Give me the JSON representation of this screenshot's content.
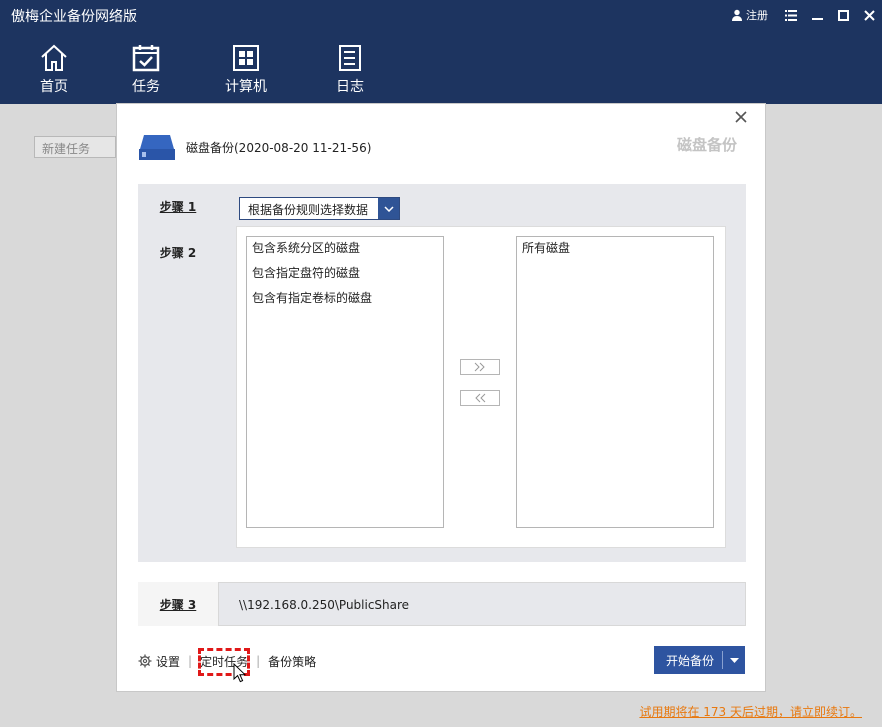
{
  "app": {
    "title": "傲梅企业备份网络版"
  },
  "window": {
    "login_label": "注册"
  },
  "nav": {
    "items": [
      {
        "label": "首页",
        "icon": "home-icon"
      },
      {
        "label": "任务",
        "icon": "task-icon"
      },
      {
        "label": "计算机",
        "icon": "computer-icon"
      },
      {
        "label": "日志",
        "icon": "log-icon"
      }
    ]
  },
  "background": {
    "new_task_label": "新建任务"
  },
  "dialog": {
    "header_text": "磁盘备份(2020-08-20 11-21-56)",
    "ghost_title": "磁盘备份",
    "steps": {
      "step1": "步骤 1",
      "step2": "步骤 2",
      "step3": "步骤 3"
    },
    "dropdown": {
      "selected": "根据备份规则选择数据"
    },
    "left_list": [
      "包含系统分区的磁盘",
      "包含指定盘符的磁盘",
      "包含有指定卷标的磁盘"
    ],
    "right_list": [
      "所有磁盘"
    ],
    "buttons": {
      "move_right": "»",
      "move_left": "«"
    },
    "step3_target": "\\\\192.168.0.250\\PublicShare",
    "bottom": {
      "settings": "设置",
      "schedule": "定时任务",
      "strategy": "备份策略",
      "start": "开始备份"
    }
  },
  "footer": {
    "trial_notice": "试用期将在 173 天后过期，请立即续订。"
  },
  "colors": {
    "nav_bg": "#1d3460",
    "accent": "#2e54a0",
    "trial": "#e8780e",
    "highlight": "#e01818"
  }
}
